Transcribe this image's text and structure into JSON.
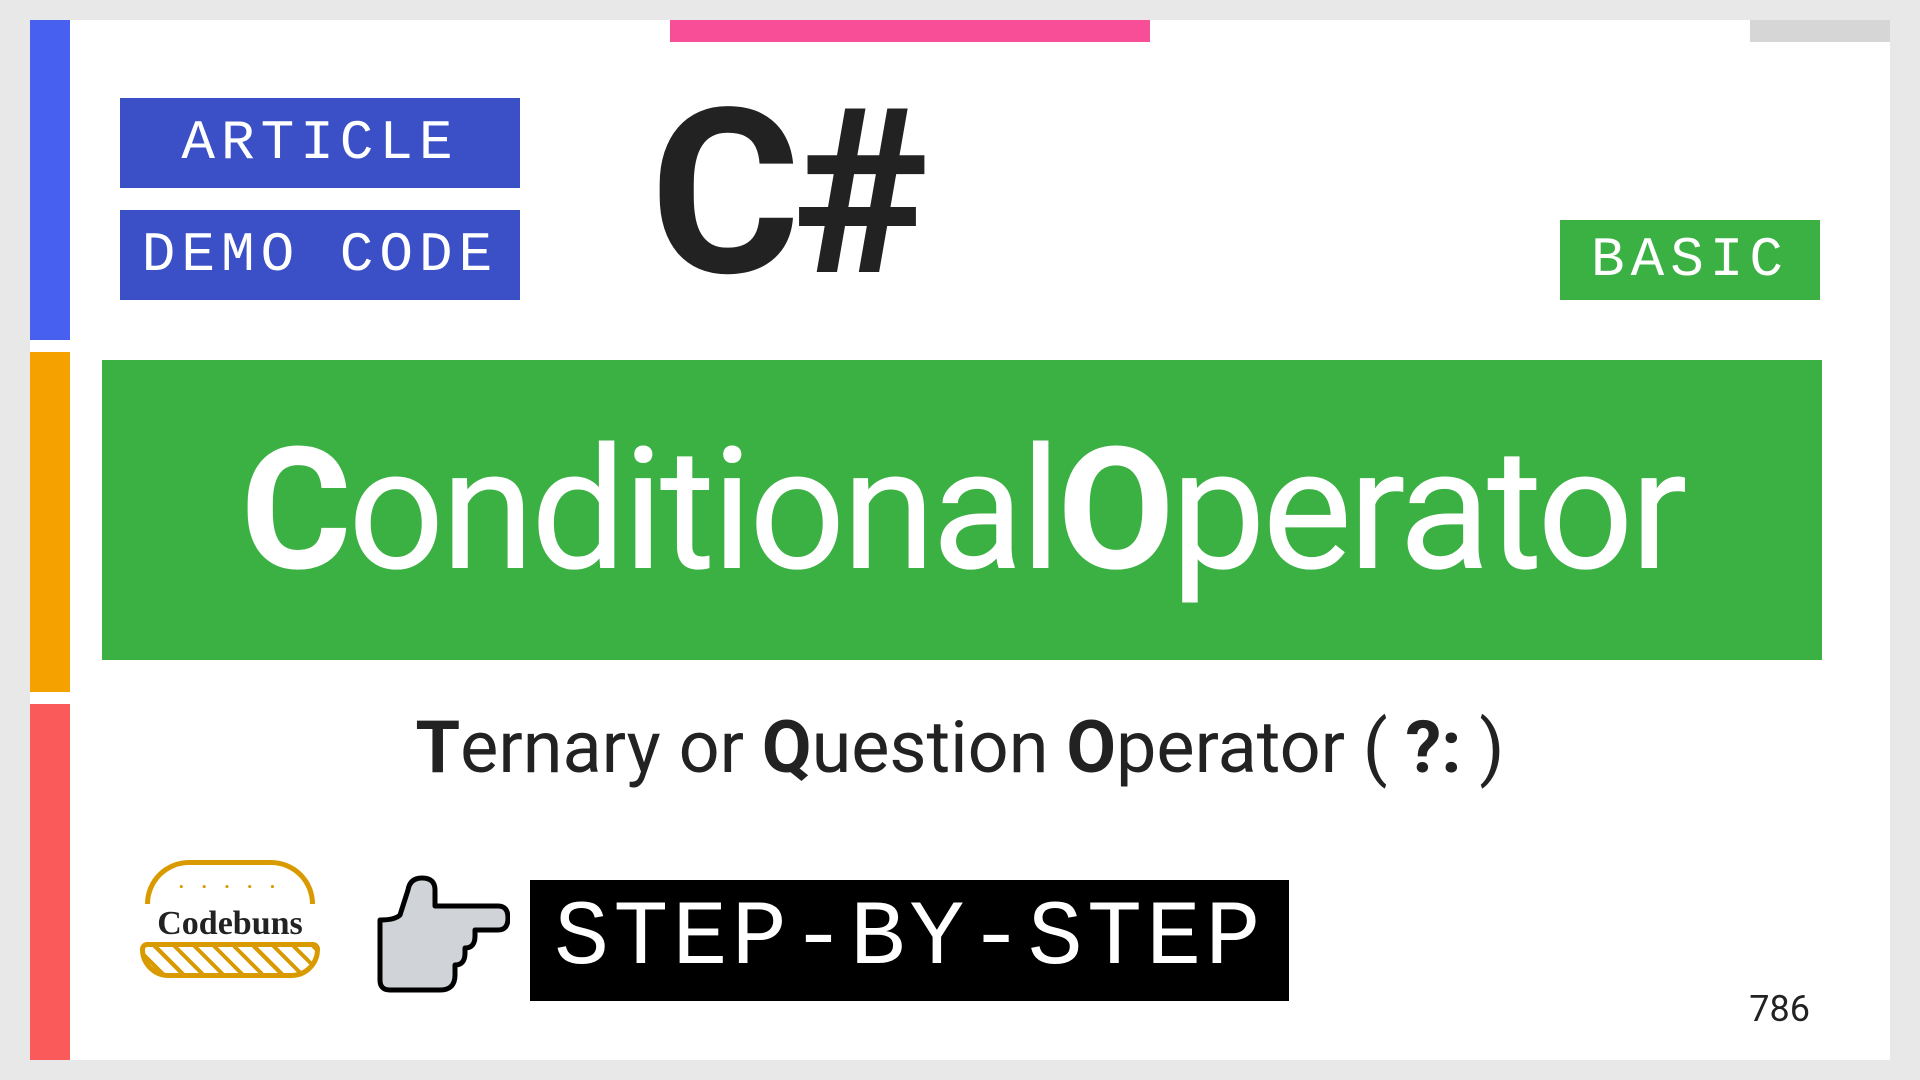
{
  "badges": {
    "article": "ARTICLE",
    "demo": "DEMO CODE",
    "basic": "BASIC"
  },
  "language": "C#",
  "title": {
    "c": "C",
    "onditional": "onditional ",
    "o": "O",
    "perator": "perator"
  },
  "subtitle": {
    "t": "T",
    "ernary": "ernary or ",
    "q": "Q",
    "uestion": "uestion ",
    "o": "O",
    "perator": "perator ( ",
    "symbol": "?:",
    "close": " )"
  },
  "logo": {
    "text": "Codebuns"
  },
  "step": "STEP-BY-STEP",
  "page": "786"
}
